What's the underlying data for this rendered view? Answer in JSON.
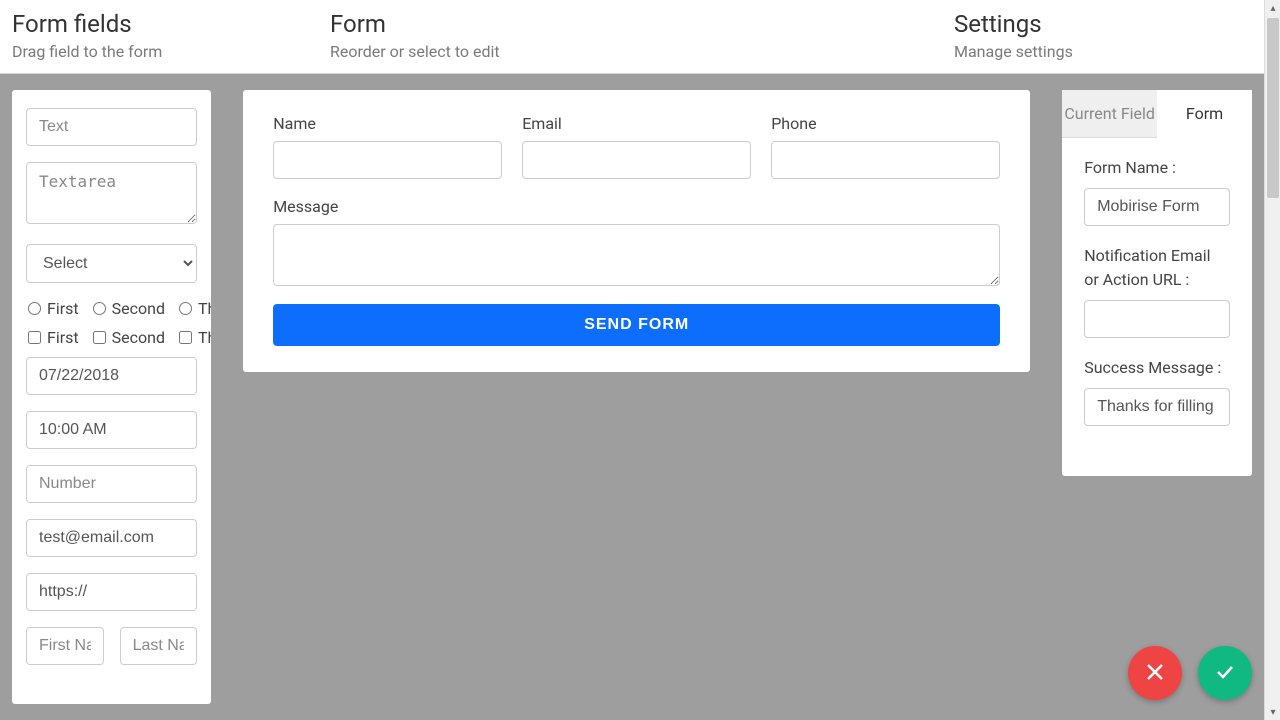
{
  "header": {
    "left": {
      "title": "Form fields",
      "sub": "Drag field to the form"
    },
    "center": {
      "title": "Form",
      "sub": "Reorder or select to edit"
    },
    "right": {
      "title": "Settings",
      "sub": "Manage settings"
    }
  },
  "palette": {
    "text_placeholder": "Text",
    "textarea_placeholder": "Textarea",
    "select_label": "Select",
    "radio_options": [
      "First",
      "Second",
      "Third"
    ],
    "checkbox_options": [
      "First",
      "Second",
      "Third"
    ],
    "date_value": "07/22/2018",
    "time_value": "10:00 AM",
    "number_placeholder": "Number",
    "email_value": "test@email.com",
    "url_value": "https://",
    "first_name_placeholder": "First Name",
    "last_name_placeholder": "Last Name"
  },
  "form": {
    "fields": {
      "name_label": "Name",
      "email_label": "Email",
      "phone_label": "Phone",
      "message_label": "Message"
    },
    "submit_label": "SEND FORM"
  },
  "settings": {
    "tabs": {
      "current_field": "Current Field",
      "form": "Form"
    },
    "form_name": {
      "label": "Form Name :",
      "value": "Mobirise Form"
    },
    "notification": {
      "label_line1": "Notification Email",
      "label_line2": "or Action URL :",
      "value": ""
    },
    "success": {
      "label": "Success Message :",
      "value": "Thanks for filling out the form!"
    }
  }
}
